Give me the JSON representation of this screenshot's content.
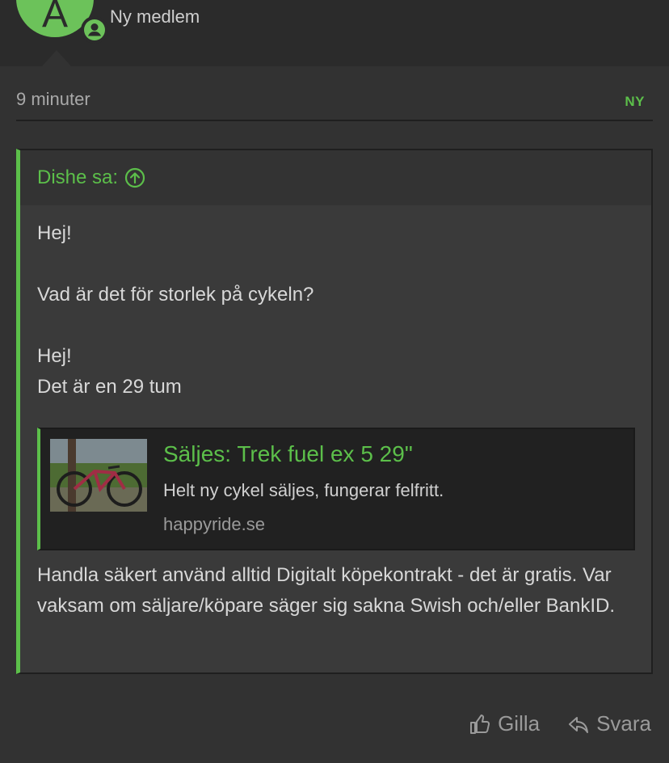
{
  "author": {
    "avatar_letter": "A",
    "title": "Ny medlem",
    "avatar_color": "#6cc25a"
  },
  "meta": {
    "time": "9 minuter",
    "badge": "NY"
  },
  "quote": {
    "header": "Dishe sa:",
    "lines": [
      "Hej!",
      "",
      "Vad är det för storlek på cykeln?",
      "",
      "Hej!",
      "Det är en 29 tum"
    ],
    "link": {
      "title": "Säljes: Trek fuel ex 5 29\"",
      "description": "Helt ny cykel säljes, fungerar felfritt.",
      "domain": "happyride.se"
    },
    "footer": "Handla säkert använd alltid Digitalt köpekontrakt - det är gratis. Var vaksam om säljare/köpare säger sig sakna Swish och/eller BankID."
  },
  "actions": {
    "like": "Gilla",
    "reply": "Svara"
  },
  "colors": {
    "accent": "#5cbf4a",
    "background": "#323232"
  },
  "icons": [
    "user-badge-icon",
    "arrow-up-circle-icon",
    "thumbs-up-icon",
    "reply-icon"
  ]
}
